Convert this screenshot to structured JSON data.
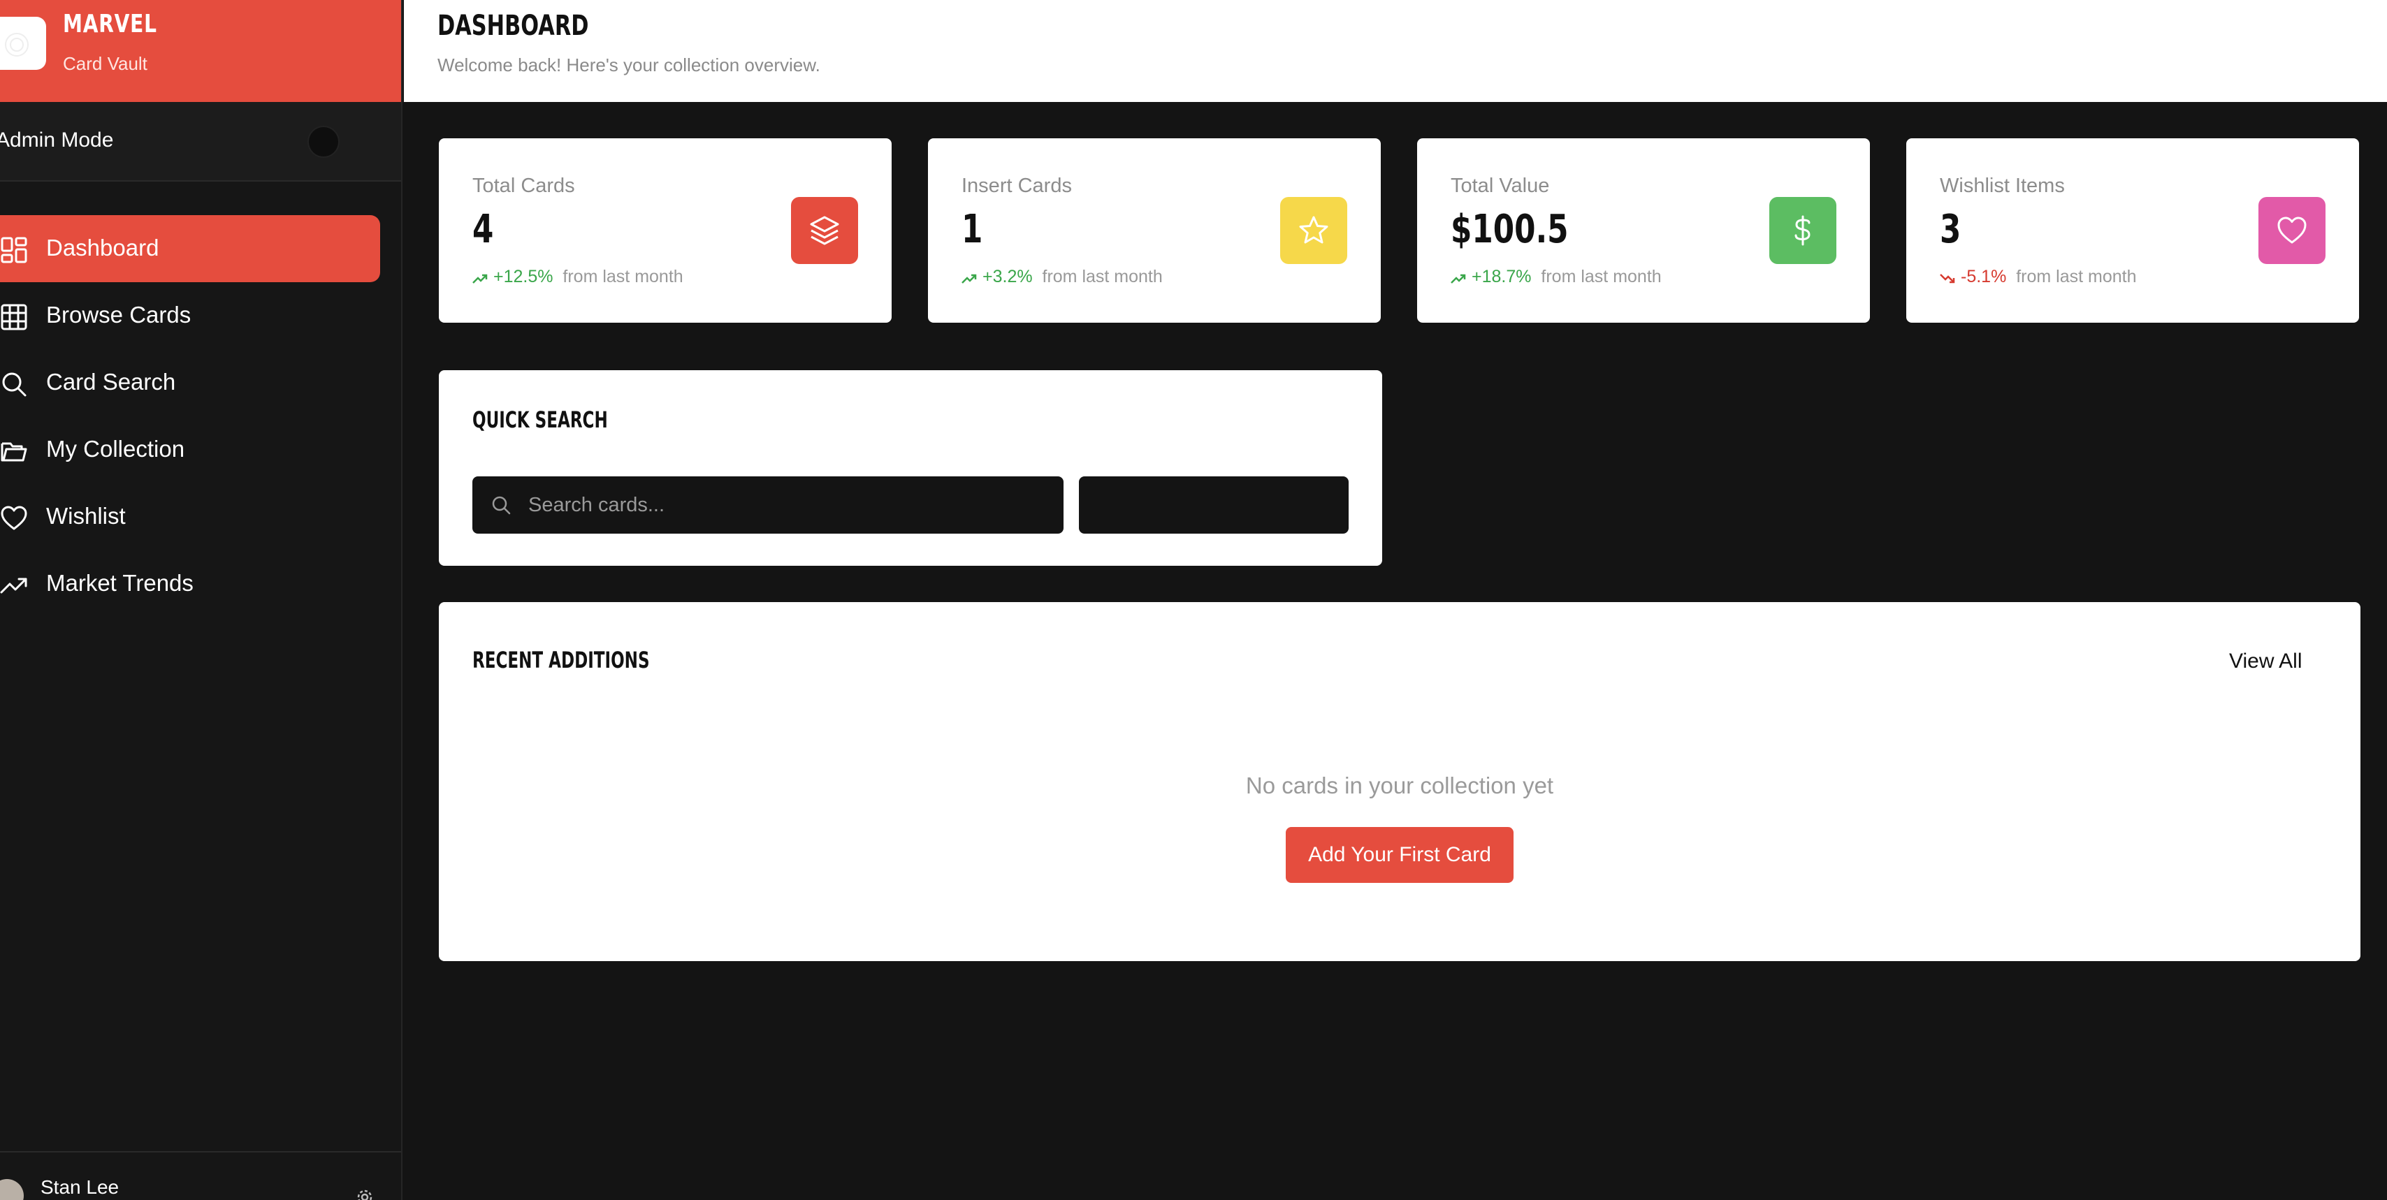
{
  "brand": {
    "title": "MARVEL",
    "subtitle": "Card Vault"
  },
  "admin": {
    "label": "Admin Mode"
  },
  "sidebar": {
    "items": [
      {
        "label": "Dashboard",
        "icon": "dashboard-icon",
        "active": true
      },
      {
        "label": "Browse Cards",
        "icon": "grid-icon"
      },
      {
        "label": "Card Search",
        "icon": "search-icon"
      },
      {
        "label": "My Collection",
        "icon": "folder-icon"
      },
      {
        "label": "Wishlist",
        "icon": "heart-icon"
      },
      {
        "label": "Market Trends",
        "icon": "trending-up-icon"
      }
    ]
  },
  "user": {
    "name": "Stan Lee"
  },
  "header": {
    "title": "DASHBOARD",
    "subtitle": "Welcome back! Here's your collection overview."
  },
  "stats": [
    {
      "label": "Total Cards",
      "value": "4",
      "change": "+12.5%",
      "note": "from last month",
      "direction": "up",
      "color": "#e54d3e",
      "icon": "layers-icon"
    },
    {
      "label": "Insert Cards",
      "value": "1",
      "change": "+3.2%",
      "note": "from last month",
      "direction": "up",
      "color": "#f6d84a",
      "icon": "star-icon"
    },
    {
      "label": "Total Value",
      "value": "$100.5",
      "change": "+18.7%",
      "note": "from last month",
      "direction": "up",
      "color": "#5cbd62",
      "icon": "dollar-icon"
    },
    {
      "label": "Wishlist Items",
      "value": "3",
      "change": "-5.1%",
      "note": "from last month",
      "direction": "down",
      "color": "#e25aa8",
      "icon": "heart-icon"
    }
  ],
  "quick_search": {
    "title": "QUICK SEARCH",
    "placeholder": "Search cards...",
    "button_label": ""
  },
  "recent": {
    "title": "RECENT ADDITIONS",
    "view_all": "View All",
    "empty_text": "No cards in your collection yet",
    "add_button": "Add Your First Card"
  },
  "colors": {
    "accent": "#e54d3e",
    "background": "#141414",
    "sidebar": "#161616",
    "up": "#3aa64a",
    "down": "#d63a2f"
  }
}
